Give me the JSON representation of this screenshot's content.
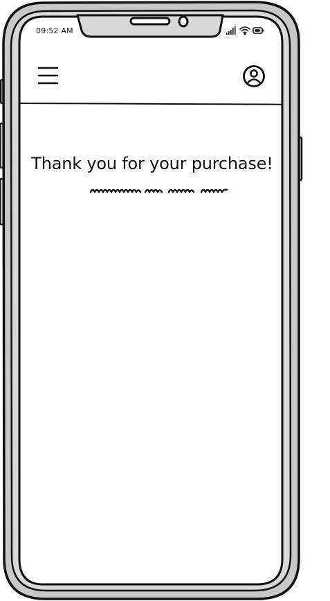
{
  "status_bar": {
    "time": "09:52 AM",
    "signal_icon": "signal-bars-icon",
    "wifi_icon": "wifi-icon",
    "battery_icon": "battery-icon"
  },
  "header": {
    "menu_icon": "hamburger-menu-icon",
    "profile_icon": "user-profile-icon"
  },
  "content": {
    "title": "Thank you for your purchase!"
  },
  "colors": {
    "frame_fill": "#c8c8c8",
    "stroke": "#111111",
    "screen": "#ffffff"
  }
}
